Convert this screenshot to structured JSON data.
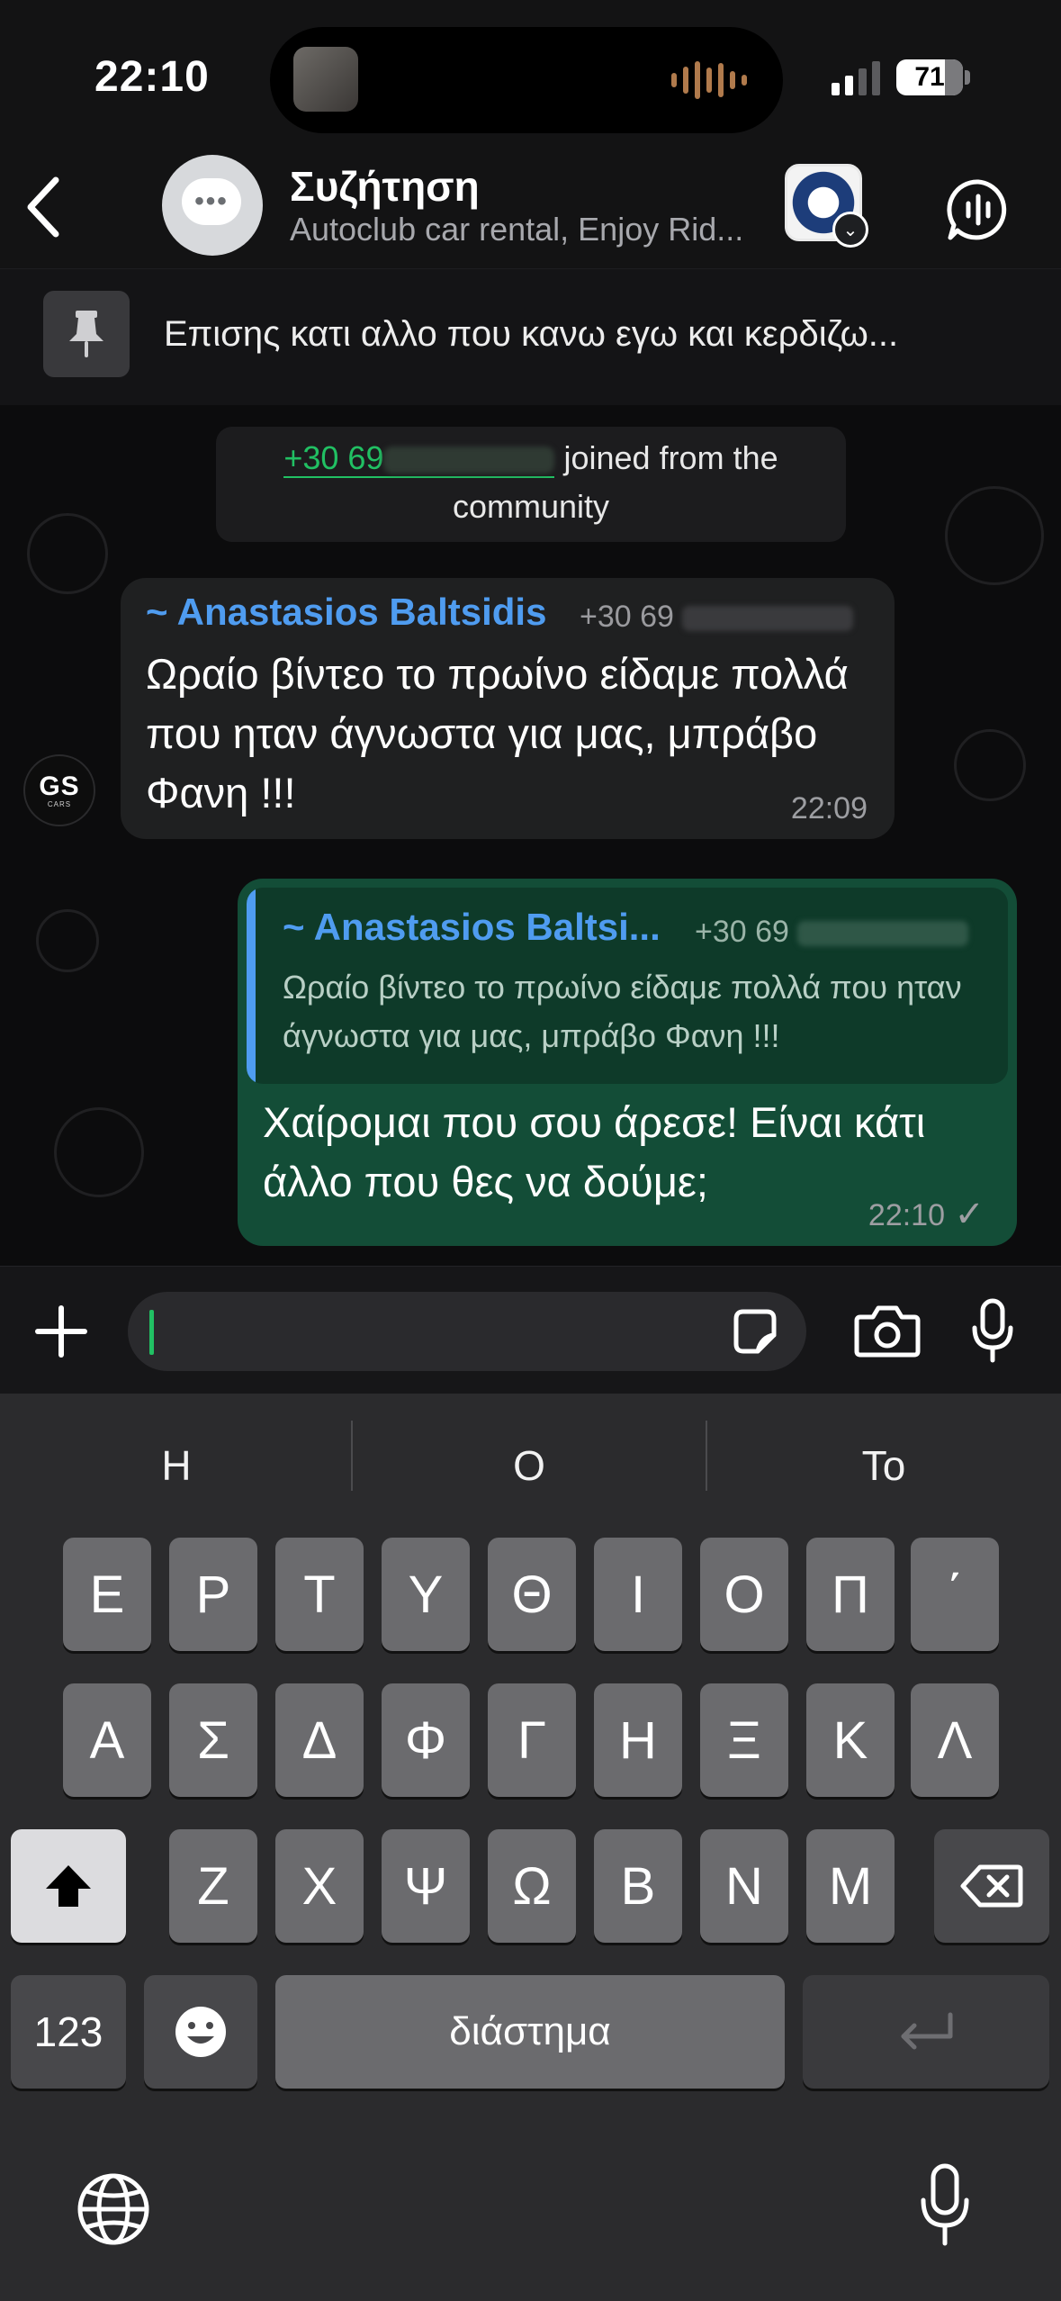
{
  "status_bar": {
    "time": "22:10",
    "battery": "71"
  },
  "header": {
    "title": "Συζήτηση",
    "subtitle": "Autoclub car rental, Enjoy Rid..."
  },
  "pinned": {
    "text": "Επισης κατι αλλο που κανω εγω και κερδιζω..."
  },
  "system_message": {
    "phone": "+30 69",
    "rest1": " joined from the",
    "rest2": "community"
  },
  "incoming": {
    "sender": "~ Anastasios Baltsidis",
    "phone": "+30 69",
    "text": "Ωραίο βίντεο το πρωίνο είδαμε πολλά που ηταν άγνωστα για μας, μπράβο Φανη !!!",
    "time": "22:09",
    "avatar_text": "GS",
    "avatar_sub": "CARS"
  },
  "outgoing": {
    "reply_sender": "~ Anastasios Baltsi...",
    "reply_phone": "+30 69",
    "reply_text": "Ωραίο βίντεο το πρωίνο είδαμε πολλά που ηταν άγνωστα για μας, μπράβο Φανη !!!",
    "text": "Χαίρομαι που σου άρεσε! Είναι κάτι άλλο που θες να δούμε;",
    "time": "22:10",
    "status": "✓"
  },
  "composer": {
    "value": ""
  },
  "keyboard": {
    "predictions": [
      "Η",
      "Ο",
      "Το"
    ],
    "row1": [
      "Ε",
      "Ρ",
      "Τ",
      "Υ",
      "Θ",
      "Ι",
      "Ο",
      "Π",
      "΄"
    ],
    "row2": [
      "Α",
      "Σ",
      "Δ",
      "Φ",
      "Γ",
      "Η",
      "Ξ",
      "Κ",
      "Λ"
    ],
    "row3": [
      "Ζ",
      "Χ",
      "Ψ",
      "Ω",
      "Β",
      "Ν",
      "Μ"
    ],
    "numbers_label": "123",
    "space_label": "διάστημα"
  },
  "colors": {
    "accent_green": "#21c063",
    "bubble_out": "#134d37",
    "name_blue": "#4f9cf0"
  }
}
